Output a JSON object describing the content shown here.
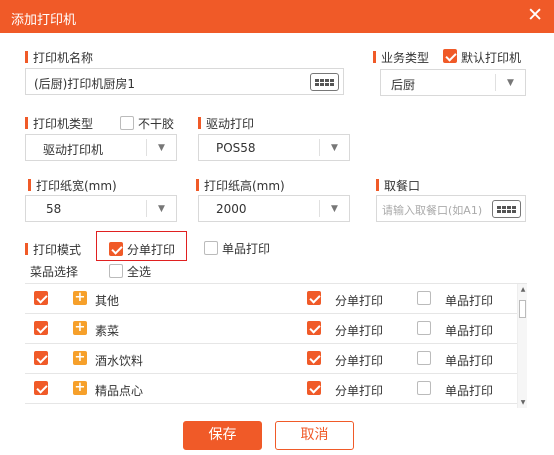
{
  "dialog": {
    "title": "添加打印机",
    "close": "✕"
  },
  "form": {
    "printer_name": {
      "label": "打印机名称",
      "value": "(后厨)打印机厨房1"
    },
    "business_type": {
      "label": "业务类型",
      "value": "后厨",
      "arrow": "▼"
    },
    "default_printer": {
      "label": "默认打印机",
      "checked": true
    },
    "printer_type": {
      "label": "打印机类型",
      "value": "驱动打印机",
      "arrow": "▼"
    },
    "not_dry_glue": {
      "label": "不干胶",
      "checked": false
    },
    "driver_print": {
      "label": "驱动打印",
      "value": "POS58",
      "arrow": "▼"
    },
    "paper_width": {
      "label": "打印纸宽(mm)",
      "value": "58",
      "arrow": "▼"
    },
    "paper_height": {
      "label": "打印纸高(mm)",
      "value": "2000",
      "arrow": "▼"
    },
    "pickup_window": {
      "label": "取餐口",
      "placeholder": "请输入取餐口(如A1)"
    },
    "print_mode": {
      "label": "打印模式",
      "split_print": {
        "label": "分单打印",
        "checked": true
      },
      "single_print": {
        "label": "单品打印",
        "checked": false
      }
    },
    "dish_select": {
      "label": "菜品选择",
      "select_all": {
        "label": "全选",
        "checked": false
      }
    }
  },
  "dish_rows": [
    {
      "name": "其他",
      "selected": true,
      "split_label": "分单打印",
      "split": true,
      "single_label": "单品打印",
      "single": false
    },
    {
      "name": "素菜",
      "selected": true,
      "split_label": "分单打印",
      "split": true,
      "single_label": "单品打印",
      "single": false
    },
    {
      "name": "酒水饮料",
      "selected": true,
      "split_label": "分单打印",
      "split": true,
      "single_label": "单品打印",
      "single": false
    },
    {
      "name": "精品点心",
      "selected": true,
      "split_label": "分单打印",
      "split": true,
      "single_label": "单品打印",
      "single": false
    }
  ],
  "icons": {
    "expand": "+",
    "scroll_up": "▲",
    "scroll_down": "▼"
  },
  "buttons": {
    "save": "保存",
    "cancel": "取消"
  },
  "colors": {
    "accent": "#f05a28",
    "expand_icon": "#f6a02a",
    "highlight": "#e02020"
  }
}
